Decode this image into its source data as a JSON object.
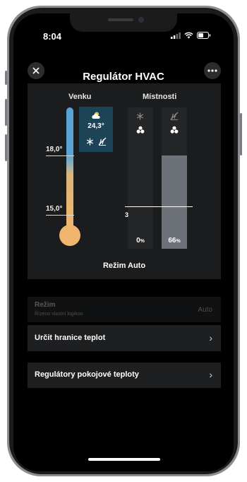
{
  "status_bar": {
    "time": "8:04"
  },
  "header": {
    "title": "Regulátor HVAC",
    "close_icon": "close-icon",
    "more_icon": "more-icon"
  },
  "panel": {
    "outside_label": "Venku",
    "rooms_label": "Místnosti",
    "outside_temp": "24,3°",
    "tick_high": "18,0°",
    "tick_low": "15,0°",
    "setpoint_value": "3",
    "heating_percent": "0",
    "cooling_percent": "66",
    "percent_unit": "%",
    "heating_level": 0,
    "cooling_level": 0.66,
    "mode_text": "Režim Auto",
    "colors": {
      "outside_cold": "#5aa3d6",
      "outside_warm": "#f0b66e",
      "weather_box": "#1d4357",
      "cooling_fill": "#6d7178"
    }
  },
  "settings": {
    "mode": {
      "label": "Režim",
      "sublabel": "Řízeno vlastní logikou",
      "value": "Auto"
    },
    "limits": {
      "label": "Určit hranice teplot"
    },
    "regulators": {
      "label": "Regulátory pokojové teploty"
    }
  }
}
